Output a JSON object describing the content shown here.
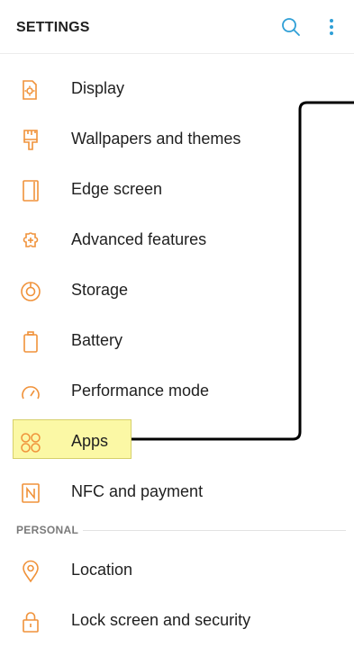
{
  "header": {
    "title": "SETTINGS"
  },
  "items": [
    {
      "label": "Display",
      "icon": "display-icon"
    },
    {
      "label": "Wallpapers and themes",
      "icon": "paintbrush-icon"
    },
    {
      "label": "Edge screen",
      "icon": "edge-screen-icon"
    },
    {
      "label": "Advanced features",
      "icon": "puzzle-plus-icon"
    },
    {
      "label": "Storage",
      "icon": "storage-icon"
    },
    {
      "label": "Battery",
      "icon": "battery-icon"
    },
    {
      "label": "Performance mode",
      "icon": "gauge-icon"
    },
    {
      "label": "Apps",
      "icon": "apps-grid-icon"
    },
    {
      "label": "NFC and payment",
      "icon": "nfc-icon"
    }
  ],
  "personal": {
    "header": "PERSONAL",
    "items": [
      {
        "label": "Location",
        "icon": "location-pin-icon"
      },
      {
        "label": "Lock screen and security",
        "icon": "lock-icon"
      }
    ]
  },
  "colors": {
    "icon_accent": "#f0923a",
    "header_icon": "#2f9fd6",
    "highlight": "#fbf8a5"
  }
}
